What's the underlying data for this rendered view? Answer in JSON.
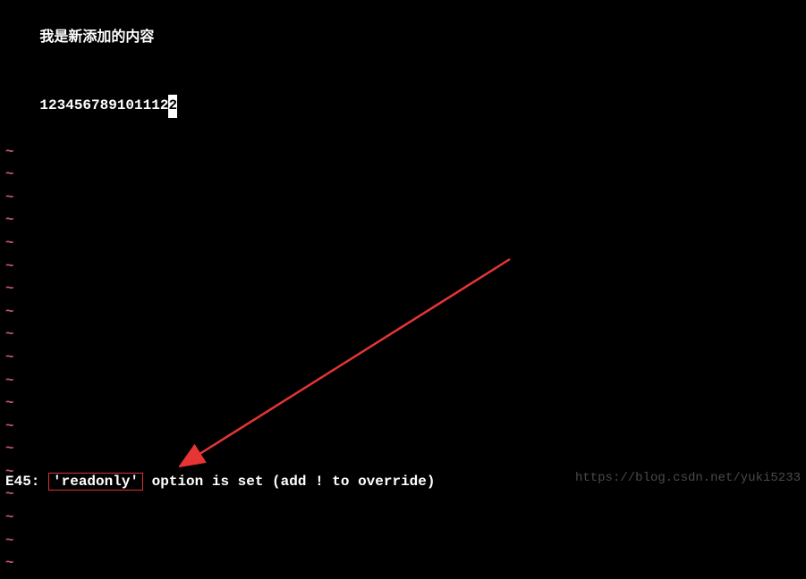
{
  "content": {
    "line1": "我是新添加的内容",
    "line2_prefix": "1234567891011",
    "line2_cursor": "12",
    "line2_last": "2"
  },
  "tildes": [
    "~",
    "~",
    "~",
    "~",
    "~",
    "~",
    "~",
    "~",
    "~",
    "~",
    "~",
    "~",
    "~",
    "~",
    "~",
    "~",
    "~",
    "~",
    "~",
    "~"
  ],
  "status": {
    "prefix": "E45: ",
    "highlighted": "'readonly'",
    "suffix": " option is set (add ! to override)"
  },
  "watermark": "https://blog.csdn.net/yuki5233"
}
